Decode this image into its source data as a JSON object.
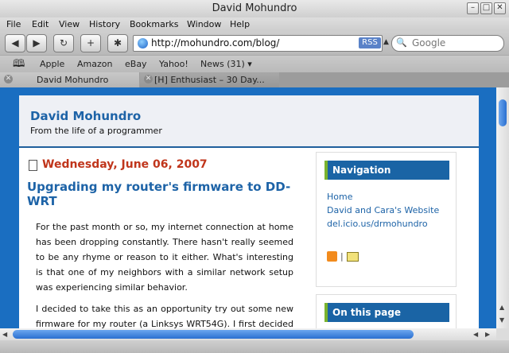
{
  "window": {
    "title": "David Mohundro"
  },
  "menu": [
    "File",
    "Edit",
    "View",
    "History",
    "Bookmarks",
    "Window",
    "Help"
  ],
  "toolbar": {
    "url": "http://mohundro.com/blog/",
    "rss_label": "RSS",
    "search_placeholder": "Google"
  },
  "bookmarks": [
    "Apple",
    "Amazon",
    "eBay",
    "Yahoo!",
    "News (31) ▾"
  ],
  "tabs": [
    {
      "label": "David Mohundro",
      "active": true
    },
    {
      "label": "[H] Enthusiast – 30 Day...",
      "active": false
    }
  ],
  "page": {
    "site_title": "David Mohundro",
    "site_subtitle": "From the life of a programmer",
    "date": "Wednesday, June 06, 2007",
    "post_title": "Upgrading my router's firmware to DD-WRT",
    "paragraphs": [
      "For the past month or so, my internet connection at home has been dropping constantly. There hasn't really seemed to be any rhyme or reason to it either. What's interesting is that one of my neighbors with a similar network setup was experiencing similar behavior.",
      "I decided to take this as an opportunity try out some new firmware for my router (a Linksys WRT54G). I first decided to check for updated official firmware. Luckily enough, there was"
    ],
    "sidebar": {
      "nav_heading": "Navigation",
      "links": [
        "Home",
        "David and Cara's Website",
        "del.icio.us/drmohundro"
      ],
      "feed_separator": "|",
      "on_this_page_heading": "On this page"
    }
  },
  "colors": {
    "accent": "#1d63a7",
    "date": "#c0351b",
    "sidebar_head": "#1a64a5"
  }
}
